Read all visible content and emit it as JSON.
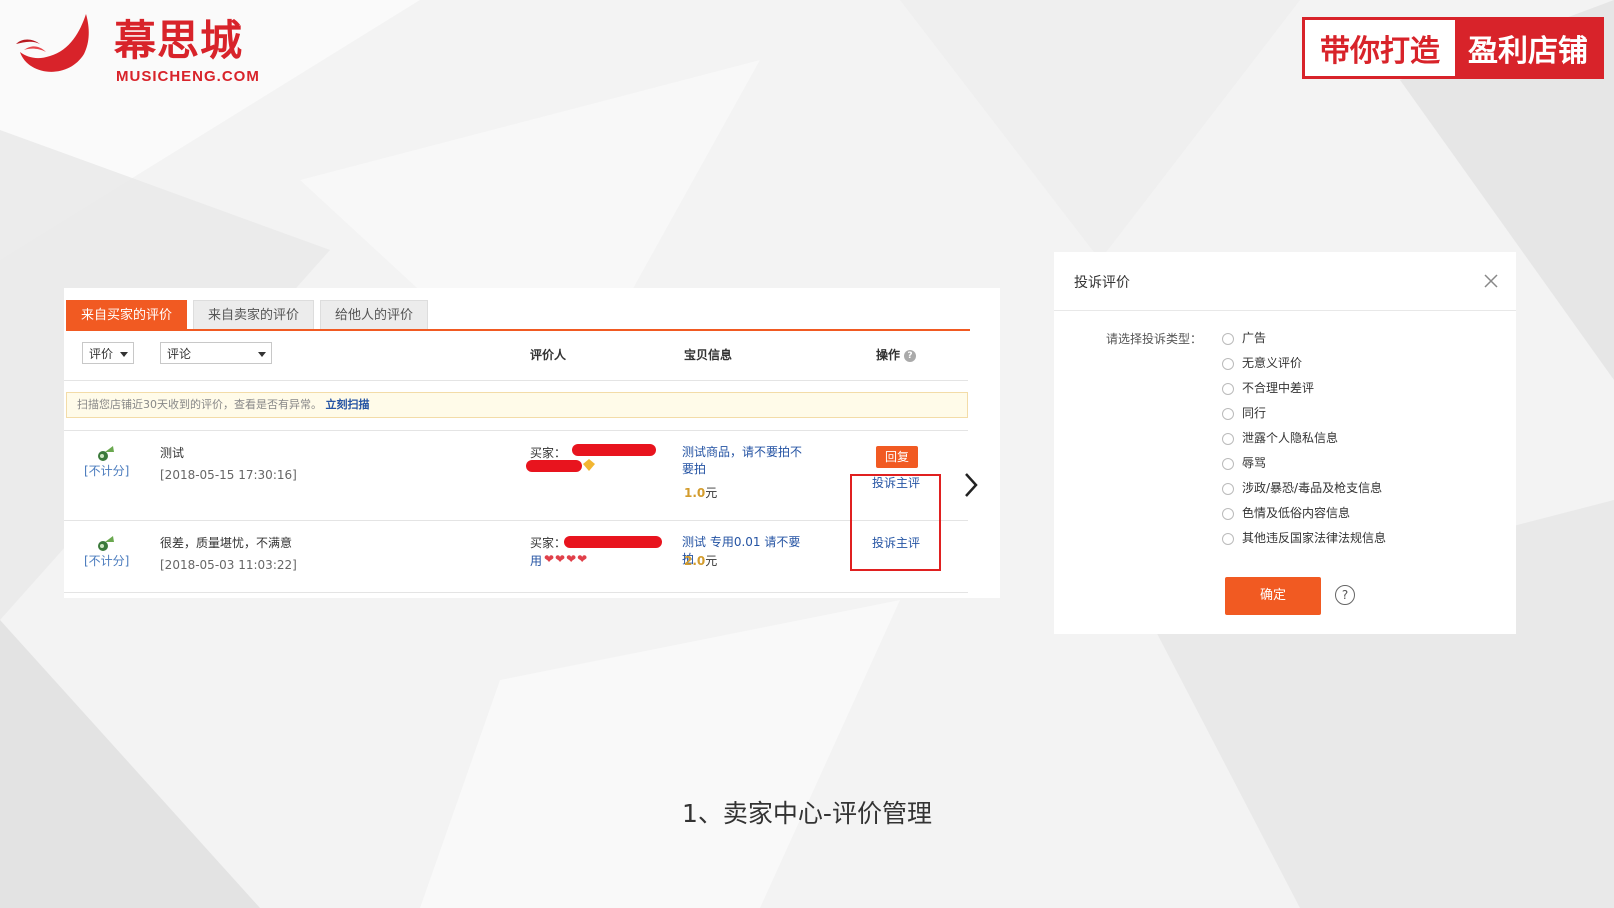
{
  "logo": {
    "cn": "幕思城",
    "en": "MUSICHENG.COM"
  },
  "slogan": {
    "left": "带你打造",
    "right": "盈利店铺"
  },
  "review_panel": {
    "tabs": [
      {
        "label": "来自买家的评价",
        "active": true
      },
      {
        "label": "来自卖家的评价",
        "active": false
      },
      {
        "label": "给他人的评价",
        "active": false
      }
    ],
    "filters": {
      "rating": "评价",
      "comment": "评论"
    },
    "columns": {
      "reviewer": "评价人",
      "item": "宝贝信息",
      "action": "操作",
      "action_help": "?"
    },
    "notice": {
      "text": "扫描您店铺近30天收到的评价，查看是否有异常。",
      "link": "立刻扫描"
    },
    "rows": [
      {
        "score_label": "[不计分]",
        "text": "测试",
        "date": "[2018-05-15 17:30:16]",
        "buyer_label": "买家：",
        "item_title": "测试商品，请不要拍不要拍",
        "price_num": "1.0",
        "price_unit": "元",
        "reply": "回复",
        "complain": "投诉主评"
      },
      {
        "score_label": "[不计分]",
        "text": "很差，质量堪忧，不满意",
        "date": "[2018-05-03 11:03:22]",
        "buyer_label": "买家：",
        "buyer_suffix": "用",
        "hearts": "❤❤❤❤",
        "item_title": "测试 专用0.01 请不要拍",
        "price_num": "2.0",
        "price_unit": "元",
        "complain": "投诉主评"
      }
    ]
  },
  "dialog": {
    "title": "投诉评价",
    "prompt": "请选择投诉类型：",
    "options": [
      "广告",
      "无意义评价",
      "不合理中差评",
      "同行",
      "泄露个人隐私信息",
      "辱骂",
      "涉政/暴恐/毒品及枪支信息",
      "色情及低俗内容信息",
      "其他违反国家法律法规信息"
    ],
    "confirm": "确定",
    "help": "?"
  },
  "caption": "1、卖家中心-评价管理",
  "colors": {
    "brand_red": "#d8232a",
    "accent_orange": "#f15a22",
    "link_blue": "#2453a3"
  }
}
